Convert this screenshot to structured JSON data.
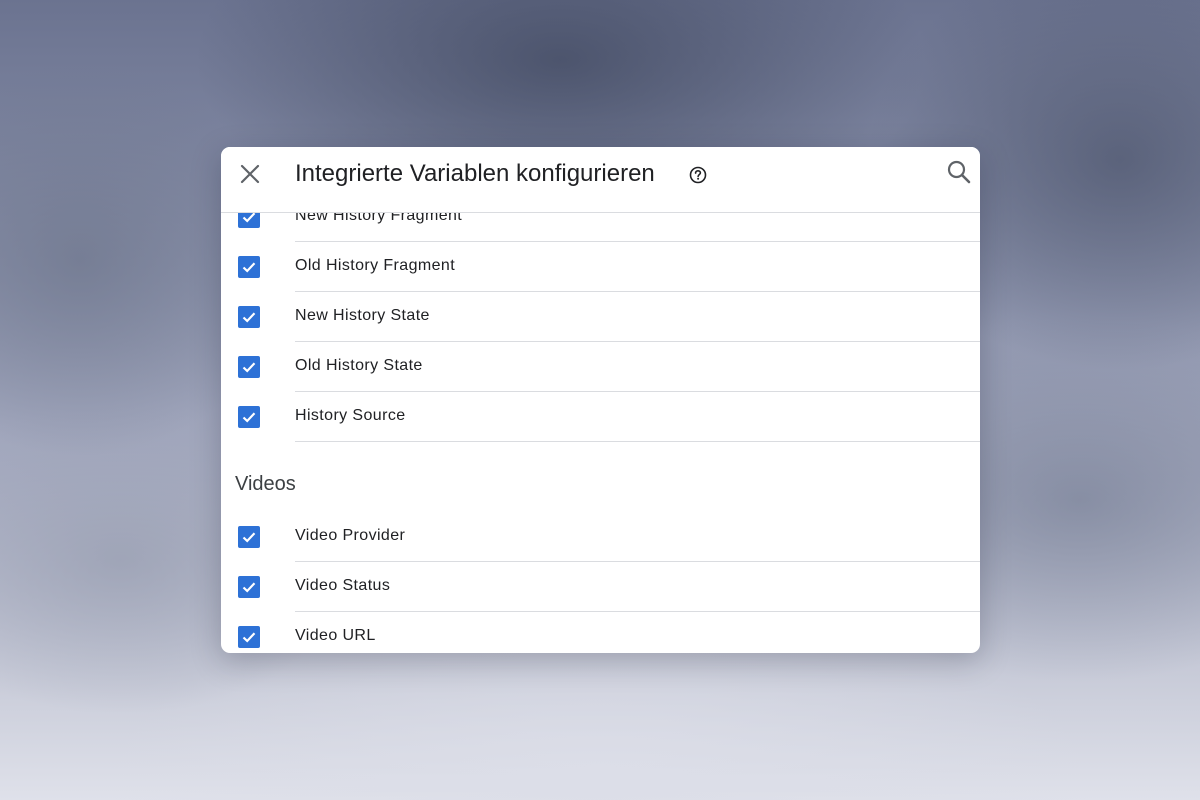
{
  "dialog": {
    "title": "Integrierte Variablen konfigurieren",
    "close_icon": "close-icon",
    "help_icon": "help-circle-icon",
    "search_icon": "search-icon",
    "accent_color": "#2d71d6"
  },
  "history_items": [
    {
      "label": "New History Fragment",
      "checked": true
    },
    {
      "label": "Old History Fragment",
      "checked": true
    },
    {
      "label": "New History State",
      "checked": true
    },
    {
      "label": "Old History State",
      "checked": true
    },
    {
      "label": "History Source",
      "checked": true
    }
  ],
  "videos_section": {
    "title": "Videos",
    "items": [
      {
        "label": "Video Provider",
        "checked": true
      },
      {
        "label": "Video Status",
        "checked": true
      },
      {
        "label": "Video URL",
        "checked": true
      }
    ]
  }
}
